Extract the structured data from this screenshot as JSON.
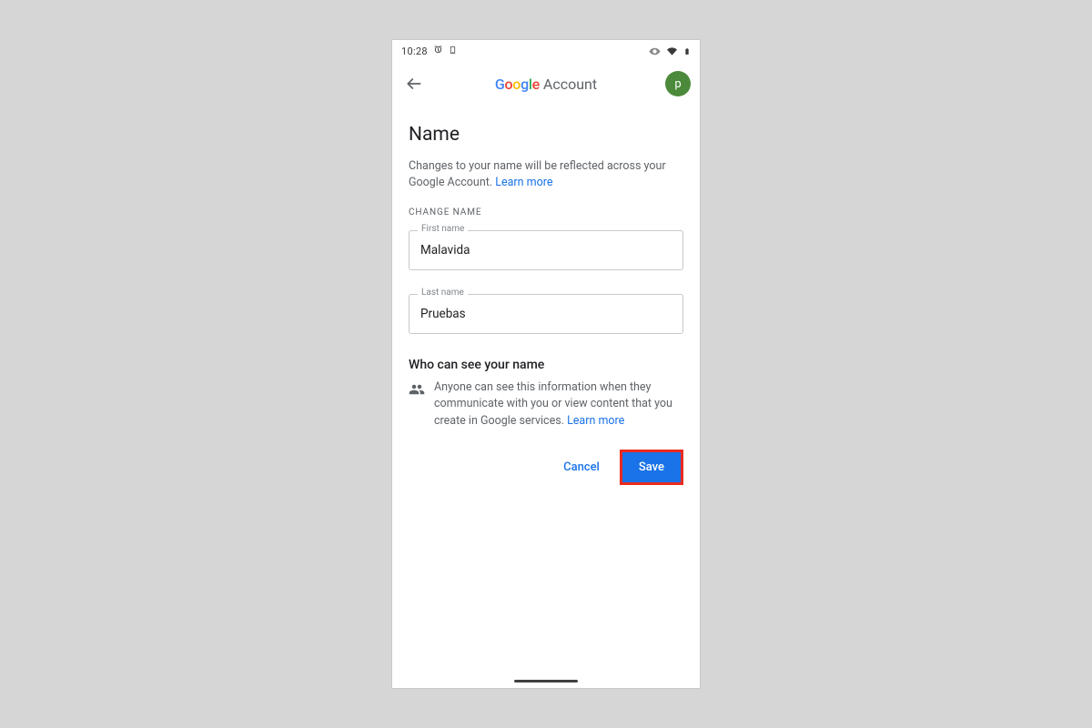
{
  "statusbar": {
    "time": "10:28"
  },
  "appbar": {
    "google_letters": [
      "G",
      "o",
      "o",
      "g",
      "l",
      "e"
    ],
    "account_word": "Account",
    "avatar_initial": "p"
  },
  "page": {
    "title": "Name",
    "helper_text": "Changes to your name will be reflected across your Google Account. ",
    "learn_more": "Learn more",
    "section_label": "CHANGE NAME"
  },
  "fields": {
    "first_name_label": "First name",
    "first_name_value": "Malavida",
    "last_name_label": "Last name",
    "last_name_value": "Pruebas"
  },
  "visibility": {
    "heading": "Who can see your name",
    "body": "Anyone can see this information when they communicate with you or view content that you create in Google services. ",
    "learn_more": "Learn more"
  },
  "actions": {
    "cancel": "Cancel",
    "save": "Save"
  }
}
